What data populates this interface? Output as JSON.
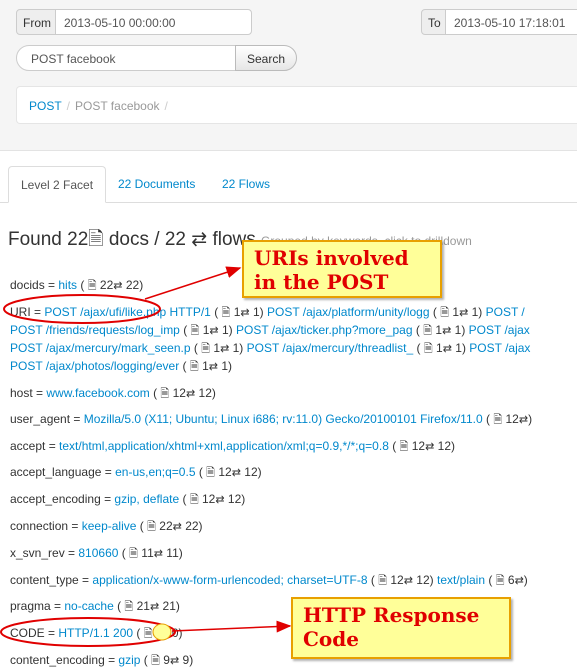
{
  "filter": {
    "from_label": "From",
    "from_value": "2013-05-10 00:00:00",
    "to_label": "To",
    "to_value": "2013-05-10 17:18:01"
  },
  "search": {
    "value": "POST facebook",
    "button": "Search"
  },
  "breadcrumb": {
    "item1": "POST",
    "item2": "POST facebook",
    "sep": "/"
  },
  "tabs": {
    "facet": "Level 2 Facet",
    "documents": "22 Documents",
    "flows": "22 Flows"
  },
  "heading": {
    "found": "Found",
    "docs_count": "22",
    "docs_word": "docs /",
    "flows_count": "22",
    "flows_word": "flows",
    "note": "Grouped by keywords, click to drilldown"
  },
  "icons": {
    "doc": "document-icon",
    "flow": "exchange-arrows-icon"
  },
  "facets": {
    "docids": {
      "key": "docids =",
      "values": [
        {
          "text": "hits",
          "docs": "22",
          "flows": "22"
        }
      ]
    },
    "uri": {
      "key": "URI =",
      "line1": [
        {
          "text": "POST /ajax/ufi/like.php HTTP/1",
          "docs": "1",
          "flows": "1"
        },
        {
          "text": "POST /ajax/platform/unity/logg",
          "docs": "1",
          "flows": "1"
        },
        {
          "text": "POST /",
          "docs": "",
          "flows": ""
        }
      ],
      "line2": [
        {
          "text": "POST /friends/requests/log_imp",
          "docs": "1",
          "flows": "1"
        },
        {
          "text": "POST /ajax/ticker.php?more_pag",
          "docs": "1",
          "flows": "1"
        },
        {
          "text": "POST /ajax",
          "docs": "",
          "flows": ""
        }
      ],
      "line3": [
        {
          "text": "POST /ajax/mercury/mark_seen.p",
          "docs": "1",
          "flows": "1"
        },
        {
          "text": "POST /ajax/mercury/threadlist_",
          "docs": "1",
          "flows": "1"
        },
        {
          "text": "POST /ajax",
          "docs": "",
          "flows": ""
        }
      ],
      "line4": [
        {
          "text": "POST /ajax/photos/logging/ever",
          "docs": "1",
          "flows": "1"
        }
      ]
    },
    "host": {
      "key": "host =",
      "values": [
        {
          "text": "www.facebook.com",
          "docs": "12",
          "flows": "12"
        }
      ]
    },
    "user_agent": {
      "key": "user_agent =",
      "values": [
        {
          "text": "Mozilla/5.0 (X11; Ubuntu; Linux i686; rv:11.0) Gecko/20100101 Firefox/11.0",
          "docs": "12",
          "flows": ""
        }
      ]
    },
    "accept": {
      "key": "accept =",
      "values": [
        {
          "text": "text/html,application/xhtml+xml,application/xml;q=0.9,*/*;q=0.8",
          "docs": "12",
          "flows": "12"
        }
      ]
    },
    "accept_language": {
      "key": "accept_language =",
      "values": [
        {
          "text": "en-us,en;q=0.5",
          "docs": "12",
          "flows": "12"
        }
      ]
    },
    "accept_encoding": {
      "key": "accept_encoding =",
      "values": [
        {
          "text": "gzip, deflate",
          "docs": "12",
          "flows": "12"
        }
      ]
    },
    "connection": {
      "key": "connection =",
      "values": [
        {
          "text": "keep-alive",
          "docs": "22",
          "flows": "22"
        }
      ]
    },
    "x_svn_rev": {
      "key": "x_svn_rev =",
      "values": [
        {
          "text": "810660",
          "docs": "11",
          "flows": "11"
        }
      ]
    },
    "content_type": {
      "key": "content_type =",
      "values": [
        {
          "text": "application/x-www-form-urlencoded; charset=UTF-8",
          "docs": "12",
          "flows": "12"
        },
        {
          "text": "text/plain",
          "docs": "6",
          "flows": ""
        }
      ]
    },
    "pragma": {
      "key": "pragma =",
      "values": [
        {
          "text": "no-cache",
          "docs": "21",
          "flows": "21"
        }
      ]
    },
    "code": {
      "key": "CODE =",
      "values": [
        {
          "text": "HTTP/1.1 200",
          "docs": "",
          "flows": "10"
        }
      ]
    },
    "content_encoding": {
      "key": "content_encoding =",
      "values": [
        {
          "text": "gzip",
          "docs": "9",
          "flows": "9"
        }
      ]
    }
  },
  "annotations": {
    "uris": "URIs involved in the POST",
    "code": "HTTP Response Code"
  },
  "colors": {
    "link": "#0088cc",
    "annotation_bg": "#ffff99",
    "annotation_text": "#e00000",
    "ellipse": "#e00000"
  }
}
